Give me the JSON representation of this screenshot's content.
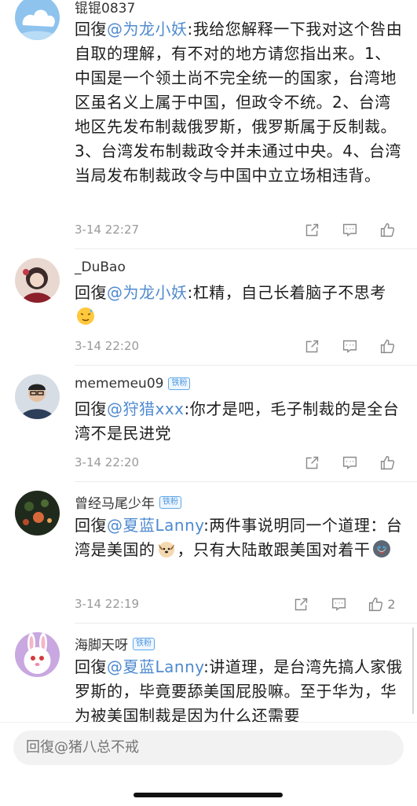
{
  "comments": [
    {
      "username": "锟锟0837",
      "badge": "",
      "reply_prefix": "回復",
      "mention": "@为龙小妖",
      "text": ":我给您解释一下我对这个咎由自取的理解，有不对的地方请您指出来。1、中国是一个领土尚不完全统一的国家，台湾地区虽名义上属于中国，但政令不统。2、台湾地区先发布制裁俄罗斯，俄罗斯属于反制裁。3、台湾发布制裁政令并未通过中央。4、台湾当局发布制裁政令与中国中立立场相违背。",
      "time": "3-14 22:27",
      "likes": ""
    },
    {
      "username": "_DuBao",
      "badge": "",
      "reply_prefix": "回復",
      "mention": "@为龙小妖",
      "text": ":杠精，自己长着脑子不思考",
      "time": "3-14 22:20",
      "likes": ""
    },
    {
      "username": "mememeu09",
      "badge": "铁粉",
      "reply_prefix": "回復",
      "mention": "@狩猎xxx",
      "text": ":你才是吧，毛子制裁的是全台湾不是民进党",
      "time": "3-14 22:20",
      "likes": ""
    },
    {
      "username": "曾经马尾少年",
      "badge": "铁粉",
      "reply_prefix": "回復",
      "mention": "@夏蓝Lanny",
      "text_a": ":两件事说明同一个道理：台湾是美国的",
      "text_b": "，只有大陆敢跟美国对着干",
      "time": "3-14 22:19",
      "likes": "2"
    },
    {
      "username": "海脚天呀",
      "badge": "铁粉",
      "reply_prefix": "回復",
      "mention": "@夏蓝Lanny",
      "text": ":讲道理，是台湾先搞人家俄罗斯的，毕竟要舔美国屁股嘛。至于华为，华为被美国制裁是因为什么还需要",
      "time": "",
      "likes": ""
    }
  ],
  "reply_input": {
    "placeholder": "回復@猪八总不戒"
  },
  "icons": {
    "share": "share-icon",
    "comment": "comment-icon",
    "like": "thumbs-up-icon",
    "emoji_sweat": "emoji-sweat-icon",
    "emoji_dog": "emoji-dog-icon",
    "emoji_husky": "emoji-husky-icon"
  },
  "colors": {
    "mention": "#4f8ad0",
    "badge": "#4f98de",
    "meta": "#9a9a9a"
  }
}
